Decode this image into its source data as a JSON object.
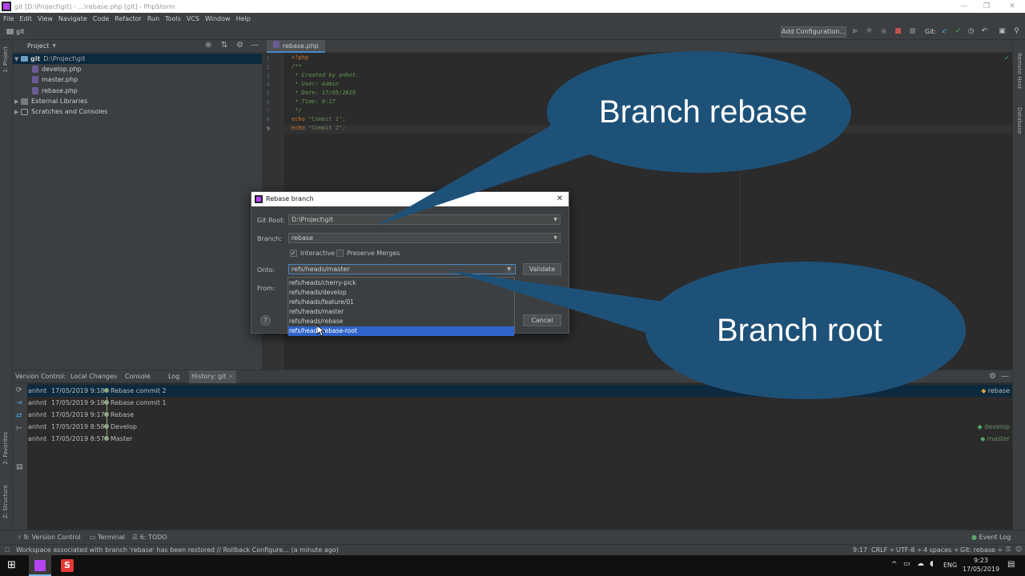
{
  "titlebar": {
    "title": "git [D:\\Project\\git] - ...\\rebase.php [git] - PhpStorm",
    "min": "—",
    "max": "❐",
    "close": "✕"
  },
  "menu": [
    "File",
    "Edit",
    "View",
    "Navigate",
    "Code",
    "Refactor",
    "Run",
    "Tools",
    "VCS",
    "Window",
    "Help"
  ],
  "navbar": {
    "crumb": "git",
    "add_config": "Add Configuration...",
    "git_label": "Git:"
  },
  "left_stripe": {
    "project": "1: Project",
    "favorites": "2: Favorites",
    "structure": "Z: Structure"
  },
  "right_stripe": {
    "remote_host": "Remote Host",
    "database": "Database"
  },
  "project_panel": {
    "title": "Project",
    "root_name": "git",
    "root_path": "D:\\Project\\git",
    "files": [
      "develop.php",
      "master.php",
      "rebase.php"
    ],
    "external_libraries": "External Libraries",
    "scratches": "Scratches and Consoles"
  },
  "editor": {
    "tab": "rebase.php",
    "line_numbers": [
      "1",
      "2",
      "3",
      "4",
      "5",
      "6",
      "7",
      "8",
      "9"
    ],
    "lines": {
      "l1": "<?php",
      "l2": "/**",
      "l3": " * Created by anhnt.",
      "l4": " * User: Admin",
      "l5": " * Date: 17/05/2019",
      "l6": " * Time: 9:17",
      "l7": " */",
      "l8_kw": "echo",
      "l8_str": " \"Commit 1\";",
      "l9_kw": "echo",
      "l9_str": " \"Commit 2\";"
    }
  },
  "dialog": {
    "title": "Rebase branch",
    "git_root_label": "Git Root:",
    "git_root_value": "D:\\Project\\git",
    "branch_label": "Branch:",
    "branch_value": "rebase",
    "interactive_label": "Interactive",
    "interactive_checked": true,
    "preserve_label": "Preserve Merges",
    "preserve_checked": false,
    "onto_label": "Onto:",
    "onto_value": "refs/heads/master",
    "from_label": "From:",
    "validate": "Validate",
    "cancel": "Cancel",
    "help": "?"
  },
  "dropdown": {
    "options": [
      "refs/heads/cherry-pick",
      "refs/heads/develop",
      "refs/heads/feature/01",
      "refs/heads/master",
      "refs/heads/rebase",
      "refs/heads/rebase-root"
    ],
    "selected_index": 5
  },
  "callouts": {
    "top": "Branch rebase",
    "bottom": "Branch root",
    "fill": "#1e5178"
  },
  "bottom_panel": {
    "tabs": [
      "Version Control:",
      "Local Changes",
      "Console",
      "Log",
      "History: git"
    ],
    "log": [
      {
        "author": "anhnt",
        "date": "17/05/2019 9:18",
        "msg": "Rebase commit 2",
        "tag": "rebase"
      },
      {
        "author": "anhnt",
        "date": "17/05/2019 9:18",
        "msg": "Rebase commit 1",
        "tag": ""
      },
      {
        "author": "anhnt",
        "date": "17/05/2019 9:17",
        "msg": "Rebase",
        "tag": ""
      },
      {
        "author": "anhnt",
        "date": "17/05/2019 8:58",
        "msg": "Develop",
        "tag": "develop"
      },
      {
        "author": "anhnt",
        "date": "17/05/2019 8:57",
        "msg": "Master",
        "tag": "master"
      }
    ]
  },
  "bottom_tools": {
    "version_control": "9: Version Control",
    "terminal": "Terminal",
    "todo": "6: TODO",
    "event_log": "Event Log"
  },
  "statusbar": {
    "message": "Workspace associated with branch 'rebase' has been restored // Rollback Configure... (a minute ago)",
    "position": "9:17",
    "line_sep": "CRLF ÷",
    "encoding": "UTF-8 ÷",
    "indent": "4 spaces ÷",
    "git_branch": "Git: rebase ÷"
  },
  "taskbar": {
    "lang": "ENG",
    "time": "9:23",
    "date": "17/05/2019"
  }
}
